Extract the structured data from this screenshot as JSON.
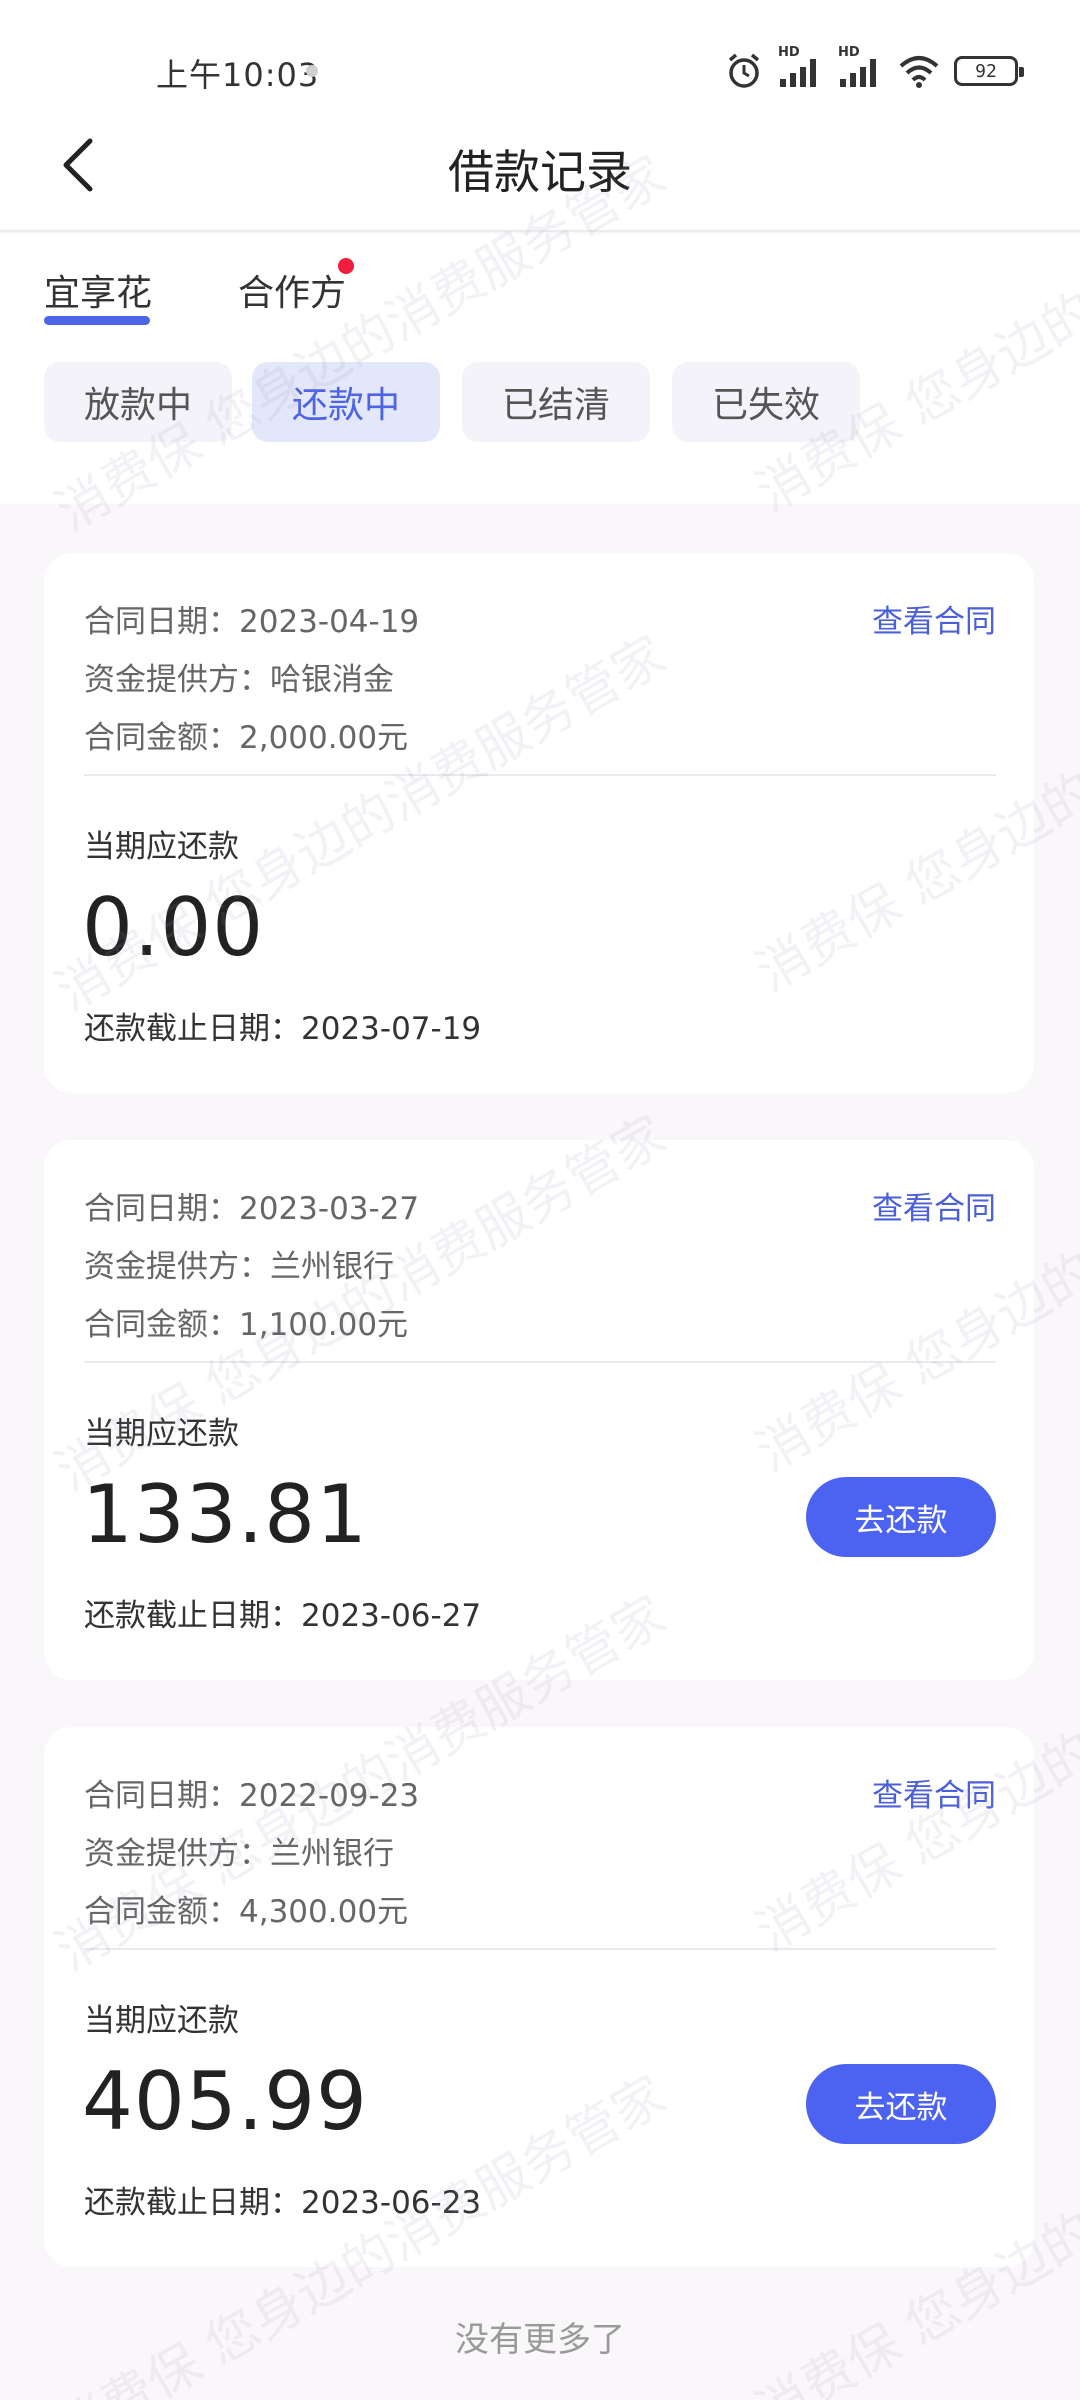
{
  "status_bar": {
    "time": "上午10:03",
    "battery": "92",
    "signal_label_1": "HD",
    "signal_label_2": "HD"
  },
  "header": {
    "title": "借款记录"
  },
  "brand_tabs": [
    {
      "label": "宜享花",
      "active": true
    },
    {
      "label": "合作方",
      "active": false
    }
  ],
  "status_filters": [
    {
      "label": "放款中",
      "active": false
    },
    {
      "label": "还款中",
      "active": true
    },
    {
      "label": "已结清",
      "active": false
    },
    {
      "label": "已失效",
      "active": false
    }
  ],
  "loans": [
    {
      "contract_date": "合同日期：2023-04-19",
      "provider": "资金提供方：哈银消金",
      "contract_amount": "合同金额：2,000.00元",
      "view_contract": "查看合同",
      "due_label": "当期应还款",
      "due_amount": "0.00",
      "deadline": "还款截止日期：2023-07-19",
      "repay_button": ""
    },
    {
      "contract_date": "合同日期：2023-03-27",
      "provider": "资金提供方：兰州银行",
      "contract_amount": "合同金额：1,100.00元",
      "view_contract": "查看合同",
      "due_label": "当期应还款",
      "due_amount": "133.81",
      "deadline": "还款截止日期：2023-06-27",
      "repay_button": "去还款"
    },
    {
      "contract_date": "合同日期：2022-09-23",
      "provider": "资金提供方：兰州银行",
      "contract_amount": "合同金额：4,300.00元",
      "view_contract": "查看合同",
      "due_label": "当期应还款",
      "due_amount": "405.99",
      "deadline": "还款截止日期：2023-06-23",
      "repay_button": "去还款"
    }
  ],
  "footer": {
    "no_more": "没有更多了"
  },
  "watermark": {
    "text_a": "消费保 您身边的消费服务管家",
    "text_b": "消费保 您身边的消费服务管家"
  },
  "colors": {
    "accent": "#4c63f1",
    "link": "#4a5fd9",
    "red_dot": "#f01e3c",
    "page_bg": "#faf7fb"
  }
}
